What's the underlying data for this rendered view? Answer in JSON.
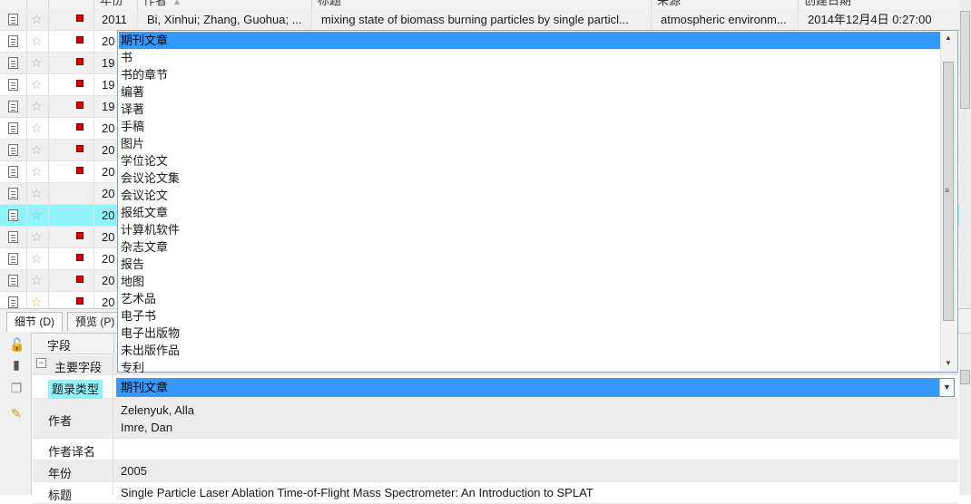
{
  "columns": {
    "year": "年份",
    "author": "作者",
    "title": "标题",
    "source": "来源",
    "created": "创建日期"
  },
  "rows": [
    {
      "year": "2011",
      "author": "Bi, Xinhui; Zhang, Guohua; ...",
      "title": "mixing state of biomass burning particles by single particl...",
      "source": "atmospheric environm...",
      "created": "2014年12月4日 0:27:00",
      "flag": true,
      "gold": false
    },
    {
      "year": "20",
      "flag": true,
      "gold": false
    },
    {
      "year": "19",
      "flag": true,
      "gold": false
    },
    {
      "year": "19",
      "flag": true,
      "gold": false
    },
    {
      "year": "19",
      "flag": true,
      "gold": false
    },
    {
      "year": "20",
      "flag": true,
      "gold": false
    },
    {
      "year": "20",
      "flag": true,
      "gold": false
    },
    {
      "year": "20",
      "flag": true,
      "gold": false
    },
    {
      "year": "20",
      "flag": false,
      "gold": false
    },
    {
      "year": "20",
      "flag": false,
      "gold": false,
      "selected": true
    },
    {
      "year": "20",
      "flag": true,
      "gold": false
    },
    {
      "year": "20",
      "flag": true,
      "gold": false
    },
    {
      "year": "20",
      "flag": true,
      "gold": false
    },
    {
      "year": "20",
      "flag": true,
      "gold": true
    }
  ],
  "tabs": {
    "details": "细节 (D)",
    "preview": "预览 (P)"
  },
  "fields": {
    "header": "字段",
    "group": "主要字段",
    "reftype_label": "题录类型",
    "author_label": "作者",
    "authors": [
      "Zelenyuk, Alla",
      "Imre, Dan"
    ],
    "translated_author_label": "作者译名",
    "year_label": "年份",
    "year_value": "2005",
    "title_label": "标题",
    "title_value": "Single Particle Laser Ablation Time-of-Flight Mass Spectrometer: An Introduction to SPLAT"
  },
  "combo": {
    "value": "期刊文章"
  },
  "options": [
    "期刊文章",
    "书",
    "书的章节",
    "编著",
    "译著",
    "手稿",
    "图片",
    "学位论文",
    "会议论文集",
    "会议论文",
    "报纸文章",
    "计算机软件",
    "杂志文章",
    "报告",
    "地图",
    "艺术品",
    "电子书",
    "电子出版物",
    "未出版作品",
    "专利"
  ],
  "colors": {
    "selection": "#3399ff",
    "selected_row": "#8ff4fb",
    "flag": "#e00000"
  }
}
